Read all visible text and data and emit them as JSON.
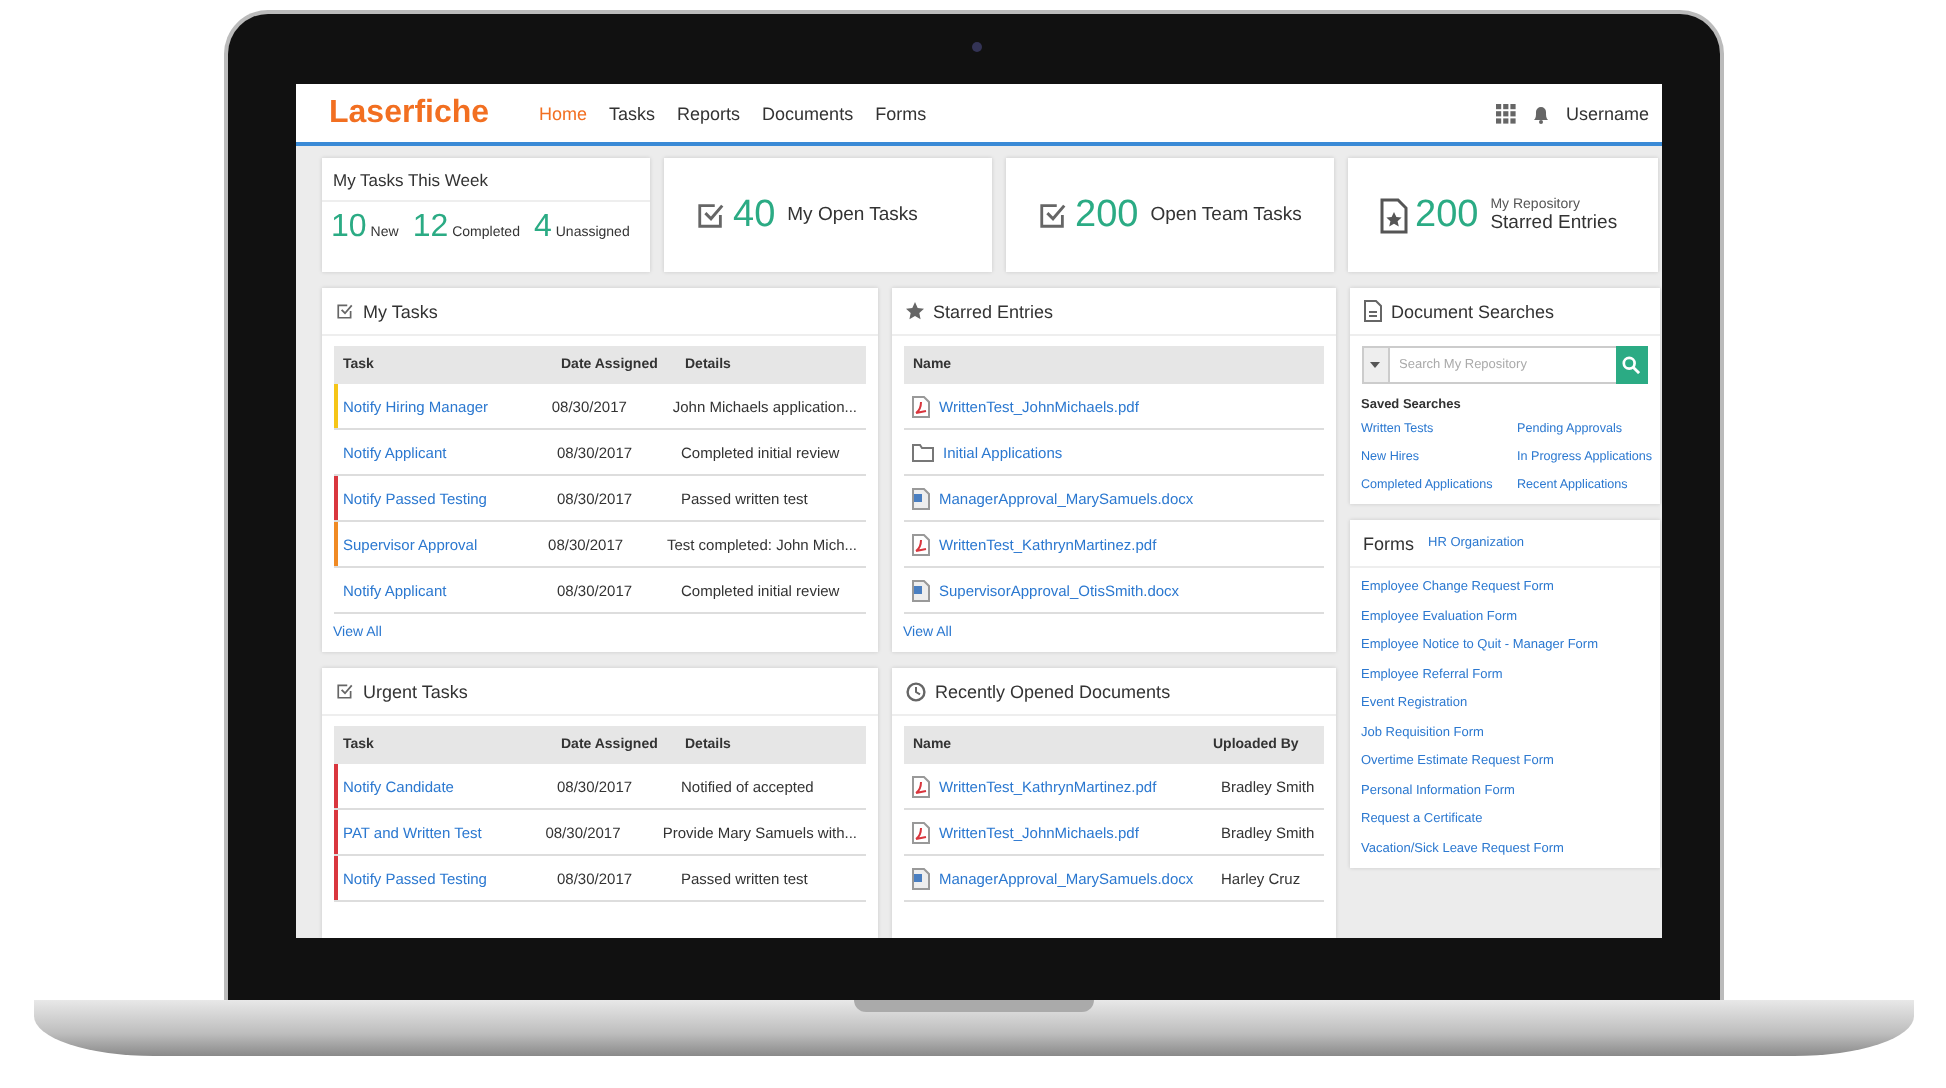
{
  "nav": {
    "logo": "Laserfiche",
    "items": [
      {
        "label": "Home",
        "selected": true
      },
      {
        "label": "Tasks",
        "selected": false
      },
      {
        "label": "Reports",
        "selected": false
      },
      {
        "label": "Documents",
        "selected": false
      },
      {
        "label": "Forms",
        "selected": false
      }
    ],
    "username": "Username"
  },
  "week": {
    "title": "My Tasks This Week",
    "stats": [
      {
        "count": "10",
        "label": "New"
      },
      {
        "count": "12",
        "label": "Completed"
      },
      {
        "count": "4",
        "label": "Unassigned"
      }
    ]
  },
  "tiles": [
    {
      "kind": "task",
      "count": "40",
      "label": "My Open Tasks"
    },
    {
      "kind": "task",
      "count": "200",
      "label": "Open Team Tasks"
    },
    {
      "kind": "starred",
      "count": "200",
      "caption": "My Repository",
      "label": "Starred Entries"
    }
  ],
  "my_tasks": {
    "title": "My Tasks",
    "columns": [
      "Task",
      "Date Assigned",
      "Details"
    ],
    "rows": [
      {
        "task": "Notify Hiring Manager",
        "date": "08/30/2017",
        "details": "John Michaels application...",
        "color": "#f5c518"
      },
      {
        "task": "Notify Applicant",
        "date": "08/30/2017",
        "details": "Completed initial review"
      },
      {
        "task": "Notify Passed Testing",
        "date": "08/30/2017",
        "details": "Passed written test",
        "color": "#d9363e"
      },
      {
        "task": "Supervisor Approval",
        "date": "08/30/2017",
        "details": "Test completed: John Mich...",
        "color": "#f08a24"
      },
      {
        "task": "Notify Applicant",
        "date": "08/30/2017",
        "details": "Completed initial review"
      }
    ],
    "link": "View All"
  },
  "urgent_tasks": {
    "title": "Urgent Tasks",
    "columns": [
      "Task",
      "Date Assigned",
      "Details"
    ],
    "rows": [
      {
        "task": "Notify Candidate",
        "date": "08/30/2017",
        "details": "Notified of accepted",
        "color": "#d9363e"
      },
      {
        "task": "PAT and Written Test",
        "date": "08/30/2017",
        "details": "Provide Mary Samuels with...",
        "color": "#d9363e"
      },
      {
        "task": "Notify Passed Testing",
        "date": "08/30/2017",
        "details": "Passed written test",
        "color": "#d9363e"
      }
    ]
  },
  "starred": {
    "title": "Starred Entries",
    "columns": [
      "Name"
    ],
    "rows": [
      {
        "kind": "pdf",
        "name": "WrittenTest_JohnMichaels.pdf"
      },
      {
        "kind": "folder",
        "name": "Initial Applications"
      },
      {
        "kind": "docx",
        "name": "ManagerApproval_MarySamuels.docx"
      },
      {
        "kind": "pdf",
        "name": "WrittenTest_KathrynMartinez.pdf"
      },
      {
        "kind": "docx",
        "name": "SupervisorApproval_OtisSmith.docx"
      }
    ],
    "link": "View All"
  },
  "recent": {
    "title": "Recently Opened Documents",
    "columns": [
      "Name",
      "Uploaded By"
    ],
    "rows": [
      {
        "kind": "pdf",
        "name": "WrittenTest_KathrynMartinez.pdf",
        "uploaded_by": "Bradley Smith"
      },
      {
        "kind": "pdf",
        "name": "WrittenTest_JohnMichaels.pdf",
        "uploaded_by": "Bradley Smith"
      },
      {
        "kind": "docx",
        "name": "ManagerApproval_MarySamuels.docx",
        "uploaded_by": "Harley Cruz"
      }
    ]
  },
  "searches": {
    "title": "Document Searches",
    "placeholder": "Search My Repository",
    "saved_title": "Saved Searches",
    "links": [
      "Written Tests",
      "Pending Approvals",
      "New Hires",
      "In Progress Applications",
      "Completed Applications",
      "Recent Applications"
    ]
  },
  "forms": {
    "title": "Forms",
    "scope": "HR Organization",
    "links": [
      "Employee Change Request Form",
      "Employee Evaluation Form",
      "Employee Notice to Quit - Manager Form",
      "Employee Referral Form",
      "Event Registration",
      "Job Requisition Form",
      "Overtime Estimate Request Form",
      "Personal Information Form",
      "Request a Certificate",
      "Vacation/Sick Leave Request Form"
    ]
  }
}
